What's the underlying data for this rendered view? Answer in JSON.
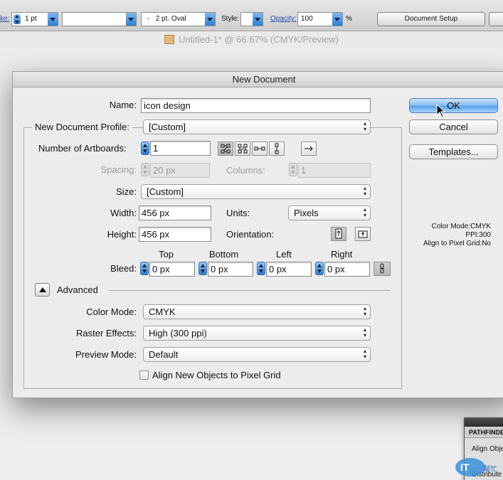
{
  "control_bar": {
    "stroke_label": "ke:",
    "stroke_weight": "1 pt",
    "brush_value": "",
    "brush_profile": "2 pt. Oval",
    "brush_dash": "-",
    "style_label": "Style:",
    "opacity_label": "Opacity:",
    "opacity_value": "100",
    "opacity_unit": "%",
    "document_setup_label": "Document Setup"
  },
  "document_title": "Untitled-1* @ 66.67% (CMYK/Preview)",
  "dialog": {
    "title": "New Document",
    "name_label": "Name:",
    "name_value": "icon design",
    "profile_label": "New Document Profile:",
    "profile_value": "[Custom]",
    "artboards_label": "Number of Artboards:",
    "artboards_value": "1",
    "spacing_label": "Spacing:",
    "spacing_value": "20 px",
    "columns_label": "Columns:",
    "columns_value": "1",
    "size_label": "Size:",
    "size_value": "[Custom]",
    "width_label": "Width:",
    "width_value": "456 px",
    "units_label": "Units:",
    "units_value": "Pixels",
    "height_label": "Height:",
    "height_value": "456 px",
    "orientation_label": "Orientation:",
    "bleed_label": "Bleed:",
    "bleed_top_label": "Top",
    "bleed_top_value": "0 px",
    "bleed_bottom_label": "Bottom",
    "bleed_bottom_value": "0 px",
    "bleed_left_label": "Left",
    "bleed_left_value": "0 px",
    "bleed_right_label": "Right",
    "bleed_right_value": "0 px",
    "advanced_label": "Advanced",
    "color_mode_label": "Color Mode:",
    "color_mode_value": "CMYK",
    "raster_label": "Raster Effects:",
    "raster_value": "High (300 ppi)",
    "preview_label": "Preview Mode:",
    "preview_value": "Default",
    "align_checkbox_label": "Align New Objects to Pixel Grid",
    "align_checked": false,
    "ok_label": "OK",
    "cancel_label": "Cancel",
    "templates_label": "Templates...",
    "info": {
      "color_mode": "Color Mode:CMYK",
      "ppi": "PPI:300",
      "align": "Align to Pixel Grid:No"
    }
  },
  "pathfinder": {
    "tab_label": "PATHFINDER",
    "align_label": "Align Obje",
    "distribute_label": "Distribute"
  },
  "watermark": {
    "text": "IT",
    "subtext": "幫忙"
  },
  "colors": {
    "accent": "#5aa2ec",
    "dialog_bg": "#ececec",
    "disabled_text": "#9a9a9a"
  }
}
